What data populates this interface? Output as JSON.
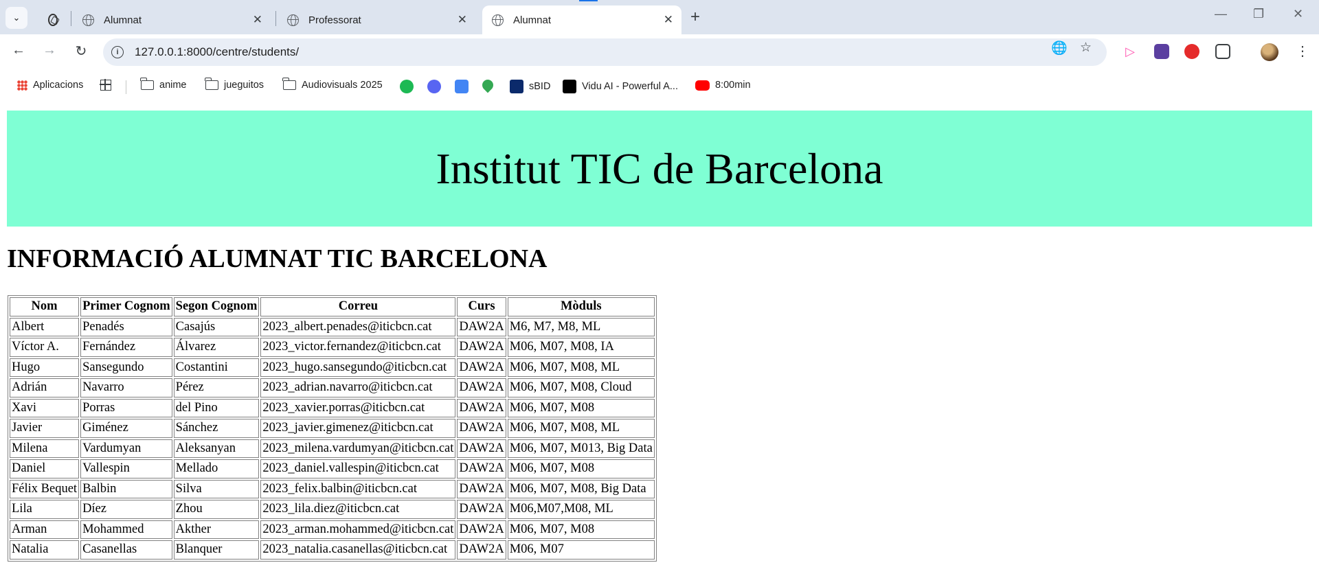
{
  "browser": {
    "tabs": [
      {
        "label": "",
        "icon": "chatgpt-icon"
      },
      {
        "label": "Alumnat",
        "icon": "globe-icon"
      },
      {
        "label": "Professorat",
        "icon": "globe-icon"
      },
      {
        "label": "Alumnat",
        "icon": "globe-icon",
        "active": true
      }
    ],
    "url": "127.0.0.1:8000/centre/students/",
    "bookmarks": [
      {
        "label": "Aplicacions",
        "icon": "apps-icon"
      },
      {
        "label": "",
        "icon": "tab-groups-icon"
      },
      {
        "label": "anime",
        "icon": "folder-icon"
      },
      {
        "label": "jueguitos",
        "icon": "folder-icon"
      },
      {
        "label": "Audiovisuals 2025",
        "icon": "folder-icon"
      },
      {
        "label": "",
        "icon": "spotify-icon"
      },
      {
        "label": "",
        "icon": "discord-icon"
      },
      {
        "label": "",
        "icon": "translate-icon"
      },
      {
        "label": "",
        "icon": "maps-icon"
      },
      {
        "label": "sBID",
        "icon": "sbid-icon"
      },
      {
        "label": "Vidu AI - Powerful A...",
        "icon": "vidu-icon"
      },
      {
        "label": "8:00min",
        "icon": "youtube-icon"
      }
    ]
  },
  "page": {
    "header": "Institut TIC de Barcelona",
    "title": "INFORMACIÓ ALUMNAT TIC BARCELONA",
    "table": {
      "headers": [
        "Nom",
        "Primer Cognom",
        "Segon Cognom",
        "Correu",
        "Curs",
        "Mòduls"
      ],
      "rows": [
        [
          "Albert",
          "Penadés",
          "Casajús",
          "2023_albert.penades@iticbcn.cat",
          "DAW2A",
          "M6, M7, M8, ML"
        ],
        [
          "Víctor A.",
          "Fernández",
          "Álvarez",
          "2023_victor.fernandez@iticbcn.cat",
          "DAW2A",
          "M06, M07, M08, IA"
        ],
        [
          "Hugo",
          "Sansegundo",
          "Costantini",
          "2023_hugo.sansegundo@iticbcn.cat",
          "DAW2A",
          "M06, M07, M08, ML"
        ],
        [
          "Adrián",
          "Navarro",
          "Pérez",
          "2023_adrian.navarro@iticbcn.cat",
          "DAW2A",
          "M06, M07, M08, Cloud"
        ],
        [
          "Xavi",
          "Porras",
          "del Pino",
          "2023_xavier.porras@iticbcn.cat",
          "DAW2A",
          "M06, M07, M08"
        ],
        [
          "Javier",
          "Giménez",
          "Sánchez",
          "2023_javier.gimenez@iticbcn.cat",
          "DAW2A",
          "M06, M07, M08, ML"
        ],
        [
          "Milena",
          "Vardumyan",
          "Aleksanyan",
          "2023_milena.vardumyan@iticbcn.cat",
          "DAW2A",
          "M06, M07, M013, Big Data"
        ],
        [
          "Daniel",
          "Vallespin",
          "Mellado",
          "2023_daniel.vallespin@iticbcn.cat",
          "DAW2A",
          "M06, M07, M08"
        ],
        [
          "Félix Bequet",
          "Balbin",
          "Silva",
          "2023_felix.balbin@iticbcn.cat",
          "DAW2A",
          "M06, M07, M08, Big Data"
        ],
        [
          "Lila",
          "Díez",
          "Zhou",
          "2023_lila.diez@iticbcn.cat",
          "DAW2A",
          "M06,M07,M08, ML"
        ],
        [
          "Arman",
          "Mohammed",
          "Akther",
          "2023_arman.mohammed@iticbcn.cat",
          "DAW2A",
          "M06, M07, M08"
        ],
        [
          "Natalia",
          "Casanellas",
          "Blanquer",
          "2023_natalia.casanellas@iticbcn.cat",
          "DAW2A",
          "M06, M07"
        ]
      ]
    }
  }
}
